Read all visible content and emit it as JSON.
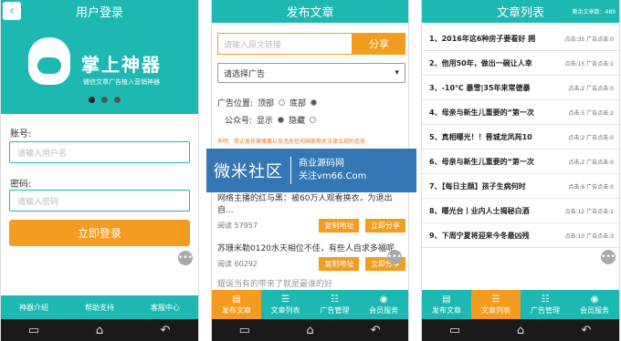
{
  "login": {
    "title": "用户登录",
    "brand": "掌上神器",
    "brand_sub": "微信文章广告植入营销神器",
    "account_label": "账号:",
    "account_placeholder": "请输入用户名",
    "password_label": "密码:",
    "password_placeholder": "请输入密码",
    "login_button": "立即登录",
    "footer": [
      "神器介绍",
      "帮助支持",
      "客服中心"
    ]
  },
  "publish": {
    "title": "发布文章",
    "link_placeholder": "请输入原文链接",
    "share_button": "分享",
    "select_ad": "请选择广告",
    "ad_position_label": "广告位置:",
    "ad_top": "顶部",
    "ad_bottom": "底部",
    "account_label": "公众号:",
    "show": "显示",
    "hide": "隐藏",
    "notice": "声明：禁止发布黄赌毒以及违反任何国家相关法律法规的信息",
    "articles": [
      {
        "title": "网络主播的红与黑：被60万人观看换衣，为退出自...",
        "reads": "阅读 57957",
        "copy": "复制地址",
        "share": "立即分享"
      },
      {
        "title": "苏珊米勒0120水天相位不佳，有些人自求多福呢",
        "reads": "阅读 60292",
        "copy": "复制地址",
        "share": "立即分享"
      },
      {
        "title": "耀诞当有的带来了就是最谁的好",
        "reads": "",
        "copy": "",
        "share": ""
      }
    ]
  },
  "tabs": [
    "发布文章",
    "文章列表",
    "广告管理",
    "会员服务"
  ],
  "watermark": {
    "main": "微米社区",
    "line1": "商业源码网",
    "line2": "关注vm66.Com"
  },
  "list": {
    "title": "文章列表",
    "remaining": "剩余文章数：489",
    "items": [
      {
        "title": "1、2016年这6种房子要看好 拥",
        "stats": "点击:35  广告点击:0"
      },
      {
        "title": "2、他用50年，做出一碗让人幸",
        "stats": "点击:15  广告点击:1"
      },
      {
        "title": "3、-10℃   暴雪|35年来常德暴",
        "stats": "点击:2  广告点击:0"
      },
      {
        "title": "4、母亲与新生儿重要的“第一次",
        "stats": "点击:5  广告点击:2"
      },
      {
        "title": "5、真相曝光！！晋城龙凤苑10",
        "stats": "点击:2  广告点击:0"
      },
      {
        "title": "6、母亲与新生儿重要的“第一次",
        "stats": "点击:2  广告点击:0"
      },
      {
        "title": "7、【每日主题】孩子生病何时",
        "stats": "点击:6  广告点击:0"
      },
      {
        "title": "8、曝光台丨业内人士揭秘白酒",
        "stats": "点击:12  广告点击:1"
      },
      {
        "title": "9、下周宁夏将迎来今冬最凶残",
        "stats": "点击:10  广告点击:3"
      }
    ]
  },
  "icons": {
    "back": "back-icon",
    "more": "more-icon",
    "home": "home-icon",
    "nav_back": "nav-back-icon",
    "recents": "recents-icon"
  },
  "colors": {
    "teal": "#1eb8b3",
    "orange": "#f39c1f",
    "watermark": "#2b6fb0"
  }
}
